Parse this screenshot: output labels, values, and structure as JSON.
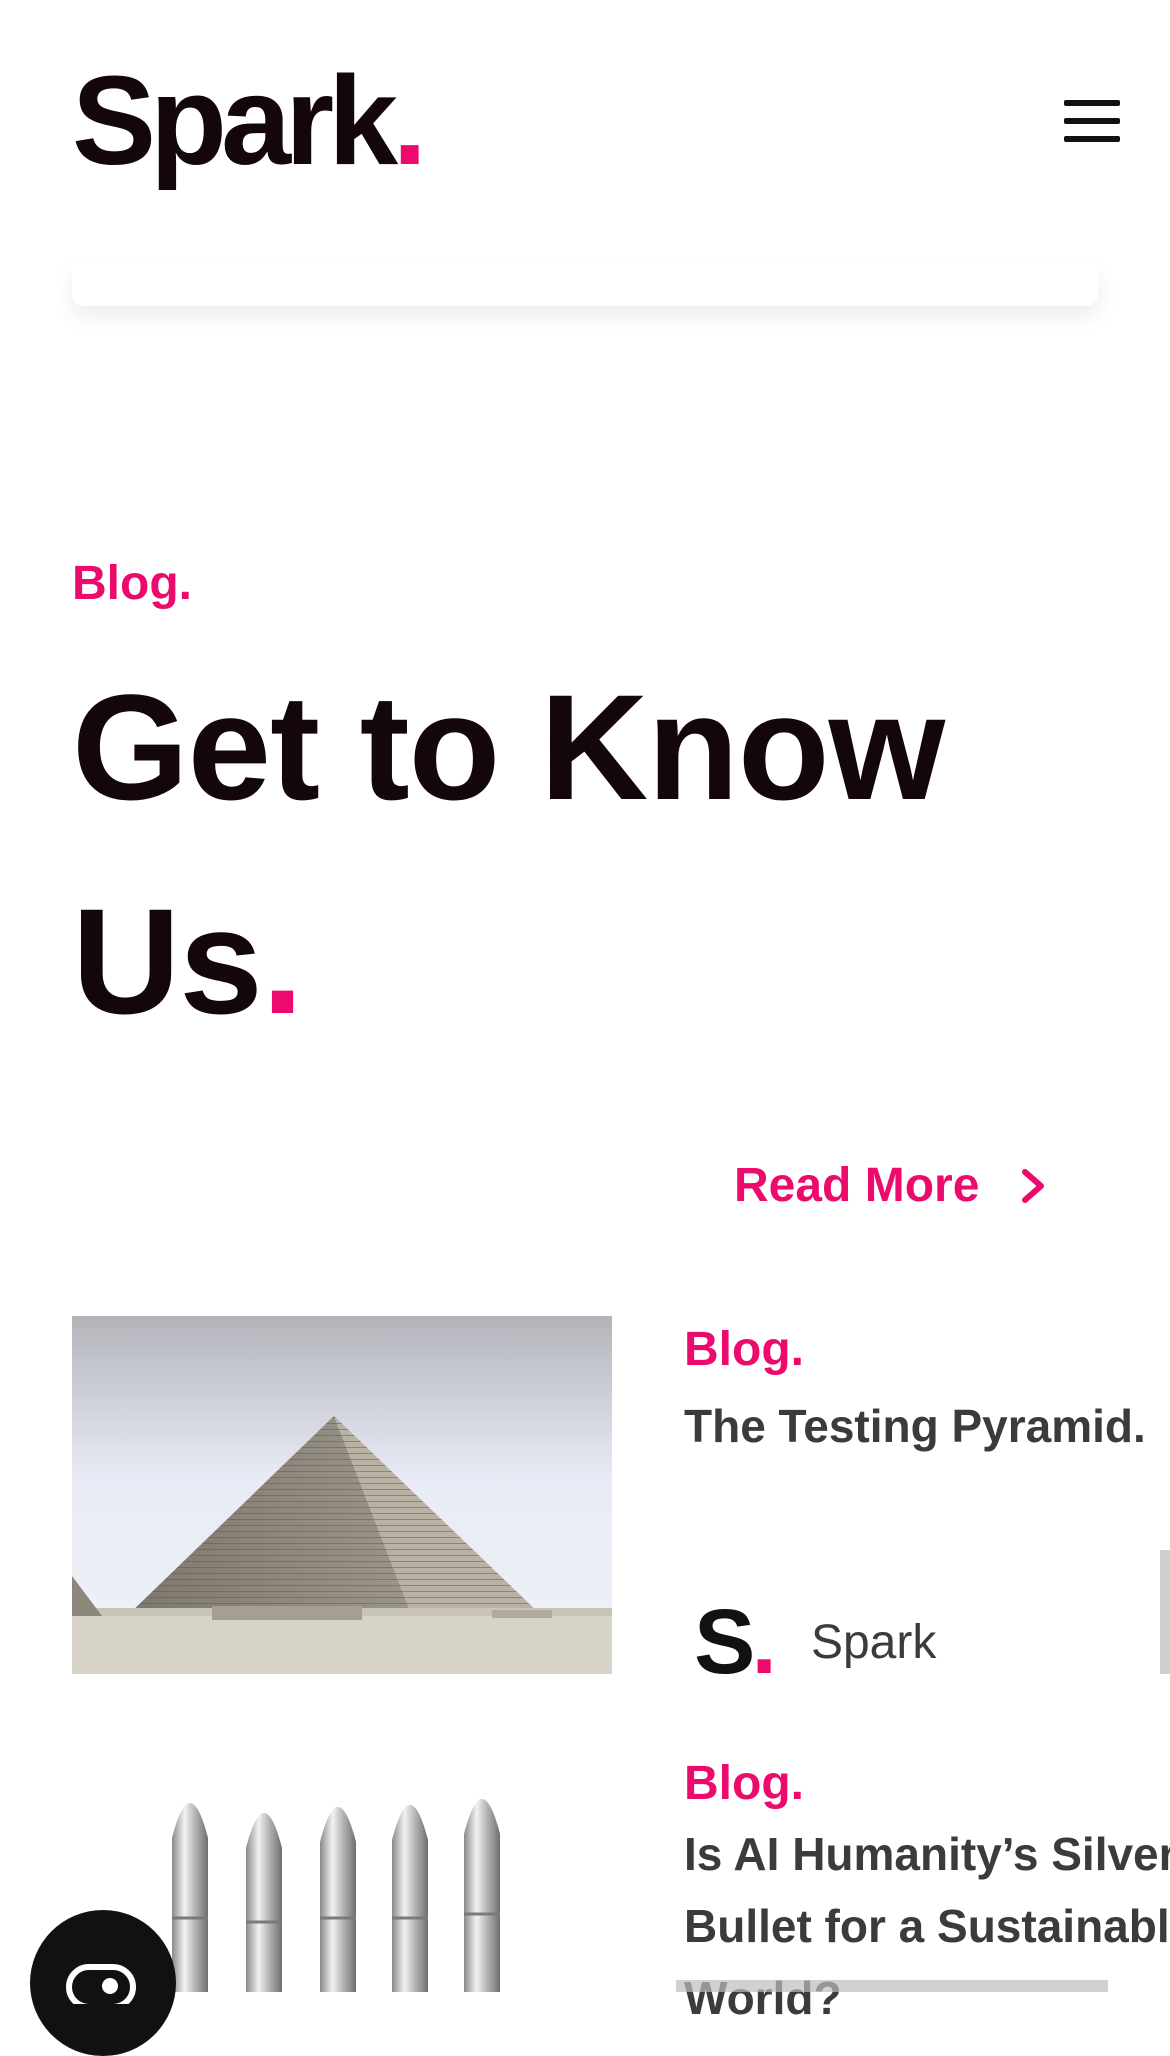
{
  "header": {
    "logo_text": "Spark",
    "logo_dot": "."
  },
  "section": {
    "eyebrow": "Blog.",
    "heading_line1": "Get to Know",
    "heading_line2": "Us",
    "heading_dot": ".",
    "read_more": "Read More"
  },
  "posts": [
    {
      "category": "Blog.",
      "title": "The Testing Pyramid.",
      "author_initial": "S",
      "author_dot": ".",
      "author_name": "Spark"
    },
    {
      "category": "Blog.",
      "title": "Is AI Humanity’s Silver Bullet for a Sustainable World?"
    }
  ],
  "colors": {
    "accent": "#ec0b6c",
    "text": "#14060d",
    "muted_text": "#3b3b3b"
  }
}
